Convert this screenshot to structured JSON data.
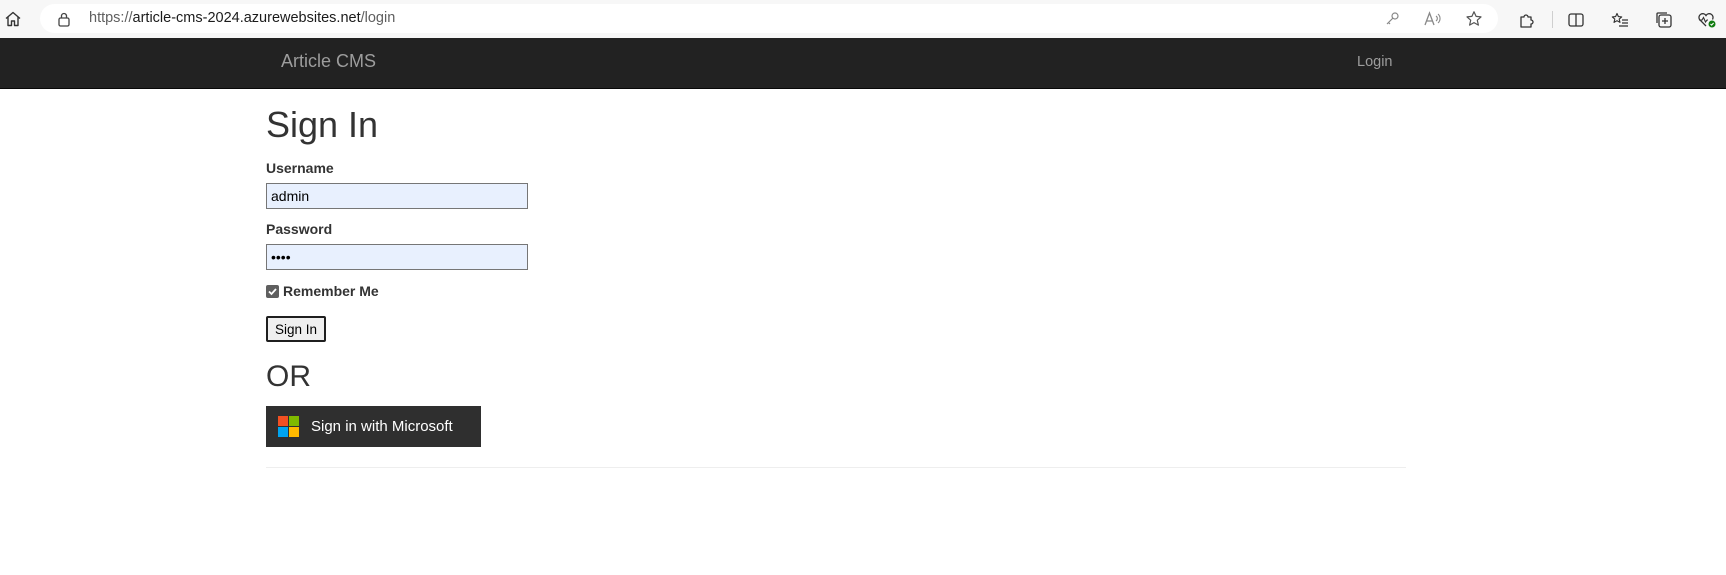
{
  "browser": {
    "url_prefix": "https://",
    "url_host": "article-cms-2024.azurewebsites.net",
    "url_path": "/login"
  },
  "navbar": {
    "brand": "Article CMS",
    "login_link": "Login"
  },
  "form": {
    "title": "Sign In",
    "username_label": "Username",
    "username_value": "admin",
    "password_label": "Password",
    "password_value": "••••",
    "remember_label": "Remember Me",
    "remember_checked": true,
    "submit_label": "Sign In",
    "or_text": "OR",
    "microsoft_button_label": "Sign in with Microsoft"
  },
  "colors": {
    "navbar_bg": "#222222",
    "navbar_text": "#9d9d9d",
    "input_autofill_bg": "#e8f0fe",
    "ms_button_bg": "#2f2f2f",
    "ms_red": "#f25022",
    "ms_green": "#7fba00",
    "ms_blue": "#00a4ef",
    "ms_yellow": "#ffb900"
  },
  "icons": {
    "home": "home-icon",
    "lock": "lock-icon",
    "key": "key-icon",
    "read_aloud": "read-aloud-icon",
    "favorite": "star-icon",
    "extensions": "puzzle-icon",
    "split_screen": "split-screen-icon",
    "favorites_list": "favorites-list-icon",
    "collections": "collections-icon",
    "browser_essentials": "heart-pulse-icon"
  }
}
